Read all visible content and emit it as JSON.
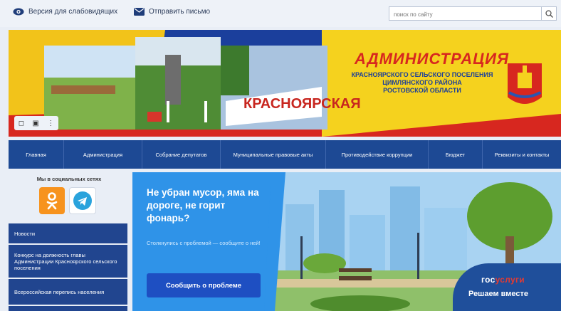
{
  "header": {
    "accessibility_link": "Версия для слабовидящих",
    "send_letter_link": "Отправить письмо",
    "search": {
      "placeholder": "поиск по сайту"
    }
  },
  "banner": {
    "sign_text": "КРАСНОЯРСКАЯ",
    "title": "АДМИНИСТРАЦИЯ",
    "subtitle_lines": [
      "КРАСНОЯРСКОГО СЕЛЬСКОГО ПОСЕЛЕНИЯ",
      "ЦИМЛЯНСКОГО РАЙОНА",
      "РОСТОВСКОЙ ОБЛАСТИ"
    ]
  },
  "nav": {
    "items": [
      {
        "label": "Главная"
      },
      {
        "label": "Администрация"
      },
      {
        "label": "Собрание депутатов"
      },
      {
        "label": "Муниципальные правовые акты"
      },
      {
        "label": "Противодействие коррупции"
      },
      {
        "label": "Бюджет"
      },
      {
        "label": "Реквизиты и контакты"
      }
    ]
  },
  "sidebar": {
    "social_title": "Мы в социальных сетях",
    "items": [
      {
        "label": "Новости"
      },
      {
        "label": "Конкурс на должность главы Администрации Красноярского сельского поселения"
      },
      {
        "label": "Всероссийская перепись населения"
      }
    ]
  },
  "promo": {
    "title": "Не убран мусор, яма на дороге, не горит фонарь?",
    "subtitle": "Столкнулись с проблемой — сообщите о ней!",
    "button": "Сообщить о проблеме",
    "gos_logo_white": "гос",
    "gos_logo_red": "услуги",
    "slogan": "Решаем вместе"
  },
  "colors": {
    "nav_bg": "#1d4994",
    "accent_red": "#d7271f",
    "promo_bg": "#2f93e8"
  }
}
